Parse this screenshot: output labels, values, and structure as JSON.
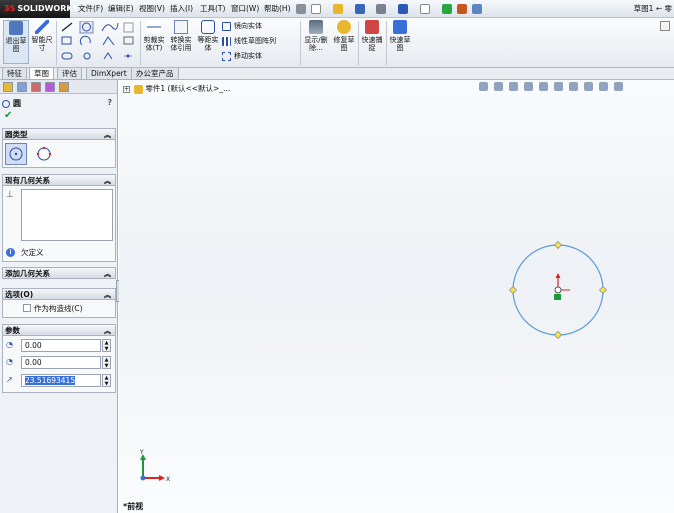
{
  "app": {
    "logo_text": "SOLIDWORKS",
    "logo_mark": "3S",
    "doc_title": "草图1 ← 零"
  },
  "menu": [
    "文件(F)",
    "编辑(E)",
    "视图(V)",
    "插入(I)",
    "工具(T)",
    "窗口(W)",
    "帮助(H)"
  ],
  "ribbon": {
    "exit_sketch": "退出草图",
    "smart_dim": "智能尺寸",
    "trim": "剪裁实体(T)",
    "convert": "转换实体引用",
    "offset": "等距实体",
    "mirror": "镜向实体",
    "linear_pattern": "线性草图阵列",
    "move": "移动实体",
    "display_delete": "显示/删除...",
    "repair": "修复草图",
    "quick_snap": "快速捕捉",
    "rapid_sketch": "快速草图"
  },
  "tabs": [
    "特征",
    "草图",
    "评估",
    "DimXpert",
    "办公室产品"
  ],
  "tabs_active": 1,
  "panel": {
    "title": "圆",
    "circle_type": {
      "header": "圆类型"
    },
    "existing_relations": {
      "header": "现有几何关系",
      "status": "欠定义"
    },
    "add_relations": {
      "header": "添加几何关系"
    },
    "options": {
      "header": "选项(O)",
      "construction": "作为构造线(C)"
    },
    "parameters": {
      "header": "参数",
      "cx": "0.00",
      "cy": "0.00",
      "radius": "23.51693415"
    }
  },
  "tree": {
    "label": "零件1 (默认<<默认>_..."
  },
  "view": {
    "name": "*前视",
    "axis_x": "X",
    "axis_y": "Y"
  },
  "colors": {
    "circle": "#5b9bd5",
    "accent": "#3a6fd8",
    "origin_red": "#d22",
    "origin_green": "#1a9a3a"
  }
}
